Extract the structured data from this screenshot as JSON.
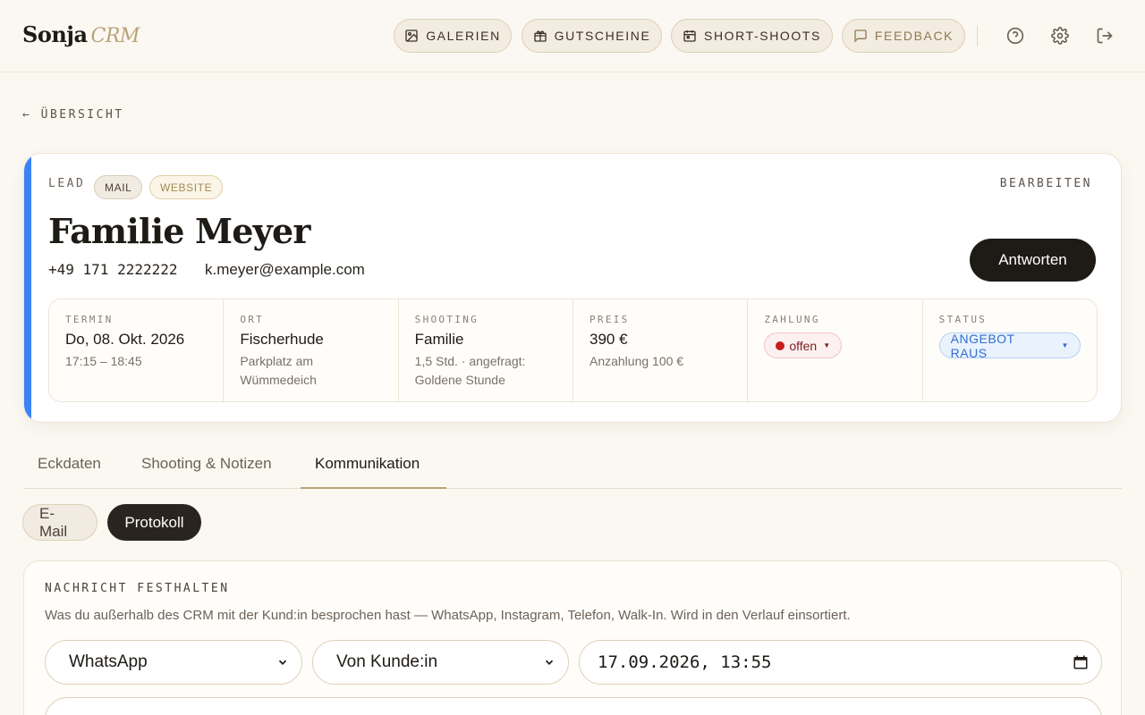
{
  "header": {
    "logo_main": "Sonja",
    "logo_sub": "CRM",
    "nav": [
      {
        "label": "GALERIEN",
        "icon": "image-icon"
      },
      {
        "label": "GUTSCHEINE",
        "icon": "gift-icon"
      },
      {
        "label": "SHORT-SHOOTS",
        "icon": "calendar-icon"
      },
      {
        "label": "FEEDBACK",
        "icon": "message-icon"
      }
    ],
    "icons": [
      "help-icon",
      "settings-icon",
      "logout-icon"
    ]
  },
  "back_link": "← ÜBERSICHT",
  "lead": {
    "label": "LEAD",
    "tags": [
      "MAIL",
      "WEBSITE"
    ],
    "edit_label": "BEARBEITEN",
    "name": "Familie Meyer",
    "phone": "+49 171 2222222",
    "email": "k.meyer@example.com",
    "reply_label": "Antworten",
    "accent_color": "#3b82f6",
    "info": {
      "termin": {
        "label": "TERMIN",
        "value": "Do, 08. Okt. 2026",
        "sub": "17:15 – 18:45"
      },
      "ort": {
        "label": "ORT",
        "value": "Fischerhude",
        "sub": "Parkplatz am Wümmedeich"
      },
      "shooting": {
        "label": "SHOOTING",
        "value": "Familie",
        "sub": "1,5 Std. · angefragt: Goldene Stunde"
      },
      "preis": {
        "label": "PREIS",
        "value": "390 €",
        "sub": "Anzahlung 100 €"
      },
      "zahlung": {
        "label": "ZAHLUNG",
        "value": "offen",
        "color": "#c81e1e"
      },
      "status": {
        "label": "STATUS",
        "value": "ANGEBOT RAUS",
        "color": "#2f6fd0"
      }
    }
  },
  "tabs": [
    {
      "label": "Eckdaten"
    },
    {
      "label": "Shooting & Notizen"
    },
    {
      "label": "Kommunikation",
      "active": true
    }
  ],
  "subtabs": [
    {
      "label": "E-Mail"
    },
    {
      "label": "Protokoll",
      "active": true
    }
  ],
  "panel": {
    "title": "NACHRICHT FESTHALTEN",
    "description": "Was du außerhalb des CRM mit der Kund:in besprochen hast — WhatsApp, Instagram, Telefon, Walk-In. Wird in den Verlauf einsortiert.",
    "channel_value": "WhatsApp",
    "direction_value": "Von Kunde:in",
    "datetime_value": "17.09.2026, 13:55"
  }
}
